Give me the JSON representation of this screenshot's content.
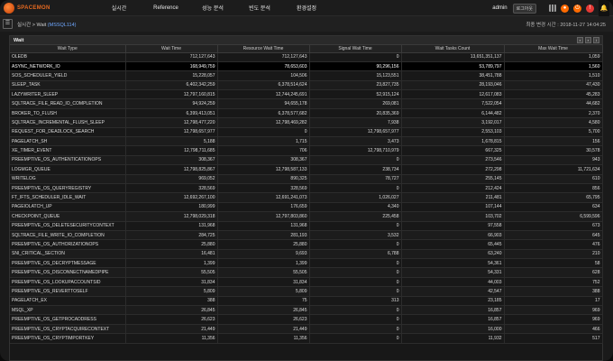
{
  "header": {
    "logo_text": "SPACEMON",
    "nav": [
      "실시간",
      "Reference",
      "성능 분석",
      "빈도 분석",
      "환경설정"
    ],
    "user": "admin",
    "logout_label": "로그아웃",
    "bell_icon": "bell-icon"
  },
  "breadcrumb": {
    "root": "실시간",
    "section": "Wait",
    "instance": "(MSSQL114)"
  },
  "refresh_time": "최종 변경 시간 : 2018-11-27 14:04:25",
  "panel": {
    "title": "Wait",
    "tools": [
      "save-icon",
      "export-icon",
      "info-icon"
    ]
  },
  "table": {
    "columns": [
      "Wait Type",
      "Wait Time",
      "Resource Wait Time",
      "Signal Wait Time",
      "Wait Tasks Count",
      "Max Wait Time"
    ],
    "selected_row": 1,
    "rows": [
      [
        "OLEDB",
        "712,127,643",
        "712,127,643",
        "0",
        "13,651,351,137",
        "1,059"
      ],
      [
        "ASYNC_NETWORK_IO",
        "168,949,759",
        "78,653,603",
        "90,296,156",
        "53,789,797",
        "1,560"
      ],
      [
        "SOS_SCHEDULER_YIELD",
        "15,228,057",
        "104,506",
        "15,123,551",
        "38,451,788",
        "1,510"
      ],
      [
        "SLEEP_TASK",
        "6,402,342,259",
        "6,378,514,624",
        "23,827,735",
        "28,193,046",
        "47,430"
      ],
      [
        "LAZYWRITER_SLEEP",
        "12,797,160,815",
        "12,744,245,691",
        "52,915,124",
        "12,617,083",
        "45,283"
      ],
      [
        "SQLTRACE_FILE_READ_IO_COMPLETION",
        "94,924,259",
        "94,655,178",
        "269,081",
        "7,522,054",
        "44,682"
      ],
      [
        "BROKER_TO_FLUSH",
        "6,399,413,051",
        "6,378,577,682",
        "20,835,369",
        "6,144,482",
        "2,370"
      ],
      [
        "SQLTRACE_INCREMENTAL_FLUSH_SLEEP",
        "12,798,477,220",
        "12,798,469,282",
        "7,938",
        "3,192,017",
        "4,580"
      ],
      [
        "REQUEST_FOR_DEADLOCK_SEARCH",
        "12,798,657,977",
        "0",
        "12,798,657,977",
        "2,553,103",
        "5,700"
      ],
      [
        "PAGELATCH_SH",
        "5,188",
        "1,715",
        "3,473",
        "1,678,815",
        "156"
      ],
      [
        "XE_TIMER_EVENT",
        "12,798,711,685",
        "706",
        "12,798,710,979",
        "667,325",
        "30,578"
      ],
      [
        "PREEMPTIVE_OS_AUTHENTICATIONOPS",
        "308,367",
        "308,367",
        "0",
        "273,546",
        "943"
      ],
      [
        "LOGMGR_QUEUE",
        "12,798,825,867",
        "12,798,587,133",
        "238,734",
        "272,298",
        "11,721,634"
      ],
      [
        "WRITELOG",
        "969,052",
        "890,325",
        "78,727",
        "255,145",
        "610"
      ],
      [
        "PREEMPTIVE_OS_QUERYREGISTRY",
        "328,569",
        "328,569",
        "0",
        "212,424",
        "856"
      ],
      [
        "FT_IFTS_SCHEDULER_IDLE_WAIT",
        "12,692,267,100",
        "12,691,241,073",
        "1,026,027",
        "211,481",
        "65,795"
      ],
      [
        "PAGEIOLATCH_UP",
        "180,999",
        "176,659",
        "4,340",
        "107,144",
        "634"
      ],
      [
        "CHECKPOINT_QUEUE",
        "12,798,029,318",
        "12,797,803,860",
        "225,458",
        "103,702",
        "6,599,596"
      ],
      [
        "PREEMPTIVE_OS_DELETESECURITYCONTEXT",
        "131,968",
        "131,968",
        "0",
        "97,558",
        "673"
      ],
      [
        "SQLTRACE_FILE_WRITE_IO_COMPLETION",
        "284,725",
        "281,193",
        "3,532",
        "66,903",
        "645"
      ],
      [
        "PREEMPTIVE_OS_AUTHORIZATIONOPS",
        "25,880",
        "25,880",
        "0",
        "65,445",
        "476"
      ],
      [
        "SNI_CRITICAL_SECTION",
        "16,481",
        "9,693",
        "6,788",
        "63,240",
        "210"
      ],
      [
        "PREEMPTIVE_OS_DECRYPTMESSAGE",
        "1,399",
        "1,399",
        "0",
        "54,361",
        "58"
      ],
      [
        "PREEMPTIVE_OS_DISCONNECTNAMEDPIPE",
        "55,505",
        "55,505",
        "0",
        "54,331",
        "628"
      ],
      [
        "PREEMPTIVE_OS_LOOKUPACCOUNTSID",
        "31,834",
        "31,834",
        "0",
        "44,003",
        "752"
      ],
      [
        "PREEMPTIVE_OS_REVERTTOSELF",
        "5,809",
        "5,809",
        "0",
        "42,547",
        "388"
      ],
      [
        "PAGELATCH_EX",
        "388",
        "75",
        "313",
        "23,185",
        "17"
      ],
      [
        "MSQL_XP",
        "26,845",
        "26,845",
        "0",
        "16,857",
        "969"
      ],
      [
        "PREEMPTIVE_OS_GETPROCADDRESS",
        "26,623",
        "26,623",
        "0",
        "16,857",
        "969"
      ],
      [
        "PREEMPTIVE_OS_CRYPTACQUIRECONTEXT",
        "21,449",
        "21,449",
        "0",
        "16,000",
        "466"
      ],
      [
        "PREEMPTIVE_OS_CRYPTIMPORTKEY",
        "11,356",
        "11,356",
        "0",
        "11,932",
        "517"
      ]
    ]
  }
}
